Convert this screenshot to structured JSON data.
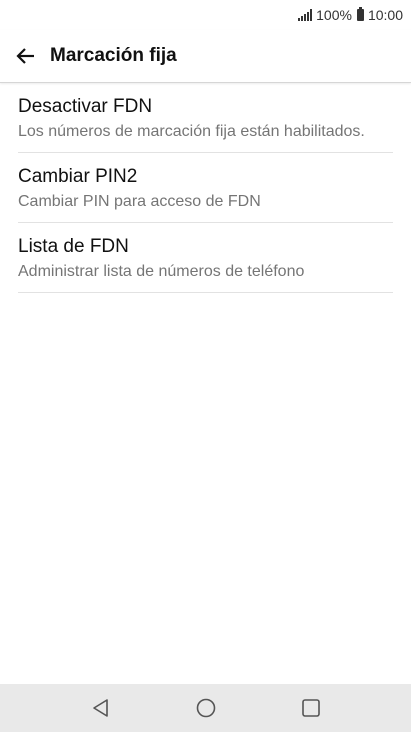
{
  "status_bar": {
    "battery_percent": "100%",
    "time": "10:00",
    "icons": [
      "signal-icon",
      "battery-icon"
    ]
  },
  "app_bar": {
    "title": "Marcación fija",
    "back_icon": "arrow-left-icon"
  },
  "settings": {
    "items": [
      {
        "title": "Desactivar FDN",
        "subtitle": "Los números de marcación fija están habilitados."
      },
      {
        "title": "Cambiar PIN2",
        "subtitle": "Cambiar PIN para acceso de FDN"
      },
      {
        "title": "Lista de FDN",
        "subtitle": "Administrar lista de números de teléfono"
      }
    ]
  },
  "nav_bar": {
    "icons": [
      "back-triangle-icon",
      "home-circle-icon",
      "recents-square-icon"
    ],
    "background": "#e9e9e9"
  }
}
